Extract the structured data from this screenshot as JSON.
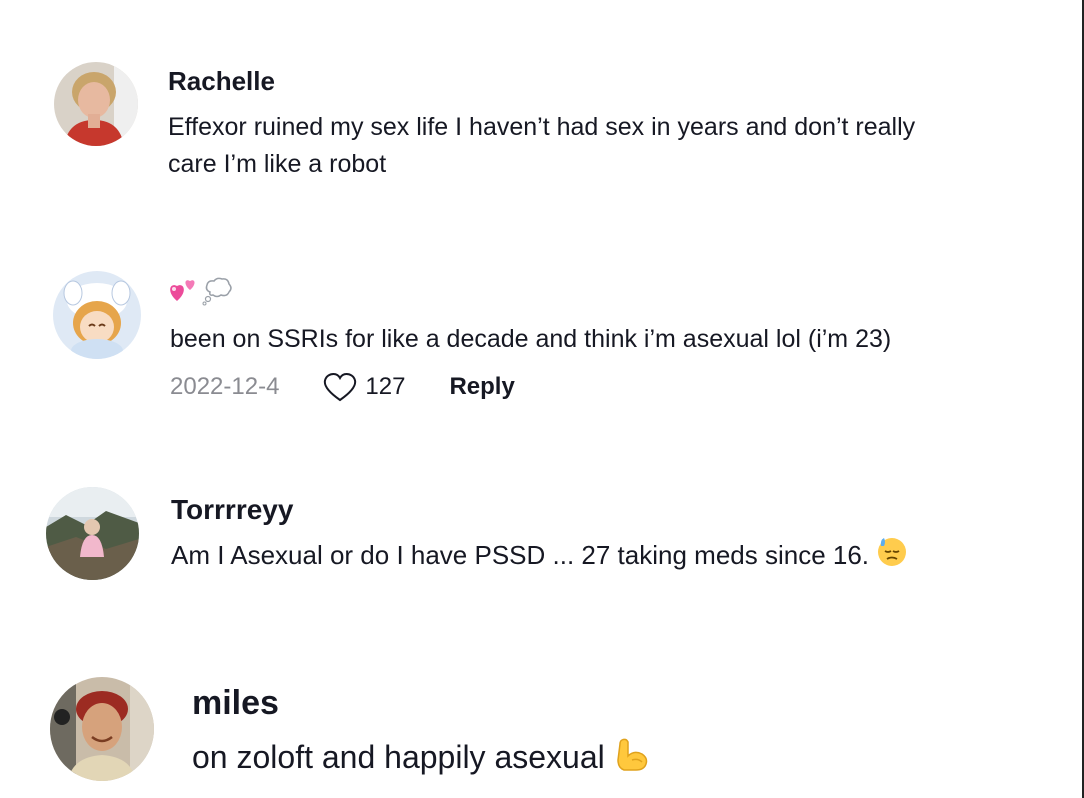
{
  "comments": [
    {
      "username": "Rachelle",
      "text_line1": "Effexor ruined my sex life I haven’t had sex in years and don’t really",
      "text_line2": "care I’m like a robot"
    },
    {
      "username_icons": [
        "sparkling-heart-icon",
        "thought-bubble-icon"
      ],
      "text": "been on SSRIs for like a decade and think i’m asexual lol (i’m 23)",
      "date": "2022-12-4",
      "likes": "127",
      "reply_label": "Reply"
    },
    {
      "username": "Torrrreyy",
      "text": "Am I Asexual or do I have PSSD ... 27 taking meds since 16.",
      "trailing_icon": "downcast-sweat-face-icon"
    },
    {
      "username": "miles",
      "text": "on zoloft and happily asexual",
      "trailing_icon": "flexed-biceps-icon"
    }
  ],
  "colors": {
    "text": "#161823",
    "secondary": "#8a8b91",
    "background": "#ffffff"
  }
}
